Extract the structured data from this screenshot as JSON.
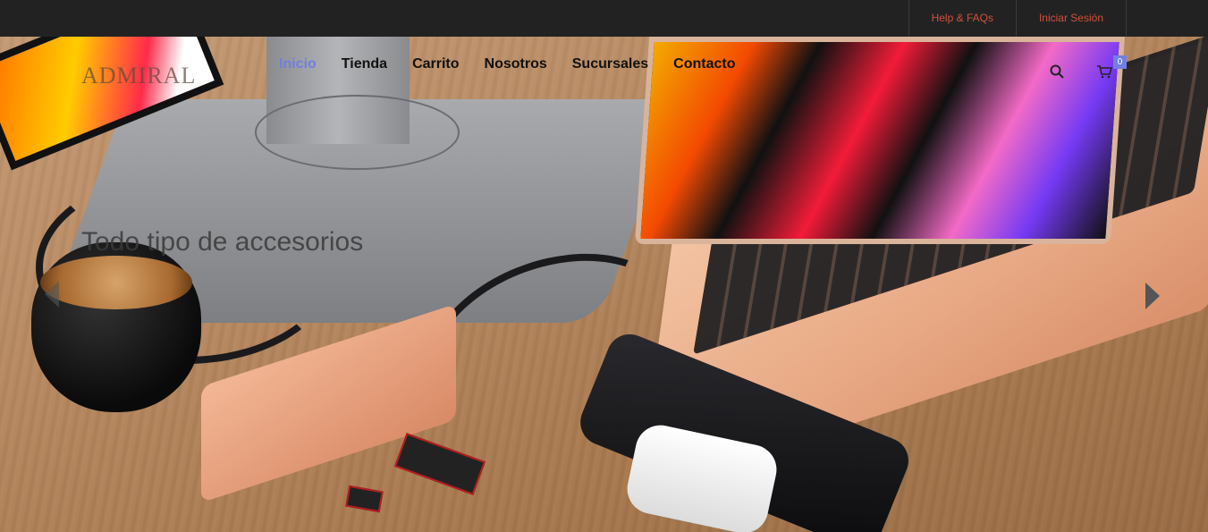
{
  "topbar": {
    "links": [
      {
        "label": "Help & FAQs"
      },
      {
        "label": "Iniciar Sesión"
      }
    ],
    "link_color": "#d0523c"
  },
  "header": {
    "logo": "ADMIRAL",
    "nav": [
      {
        "label": "Inicio",
        "active": true
      },
      {
        "label": "Tienda",
        "active": false
      },
      {
        "label": "Carrito",
        "active": false
      },
      {
        "label": "Nosotros",
        "active": false
      },
      {
        "label": "Sucursales",
        "active": false
      },
      {
        "label": "Contacto",
        "active": false
      }
    ],
    "accent_color": "#717fe0",
    "icons": {
      "search": "search-icon",
      "cart": "cart-icon"
    },
    "cart_count": "0"
  },
  "slider": {
    "caption": "Todo tipo de accesorios",
    "prev_icon": "chevron-left-icon",
    "next_icon": "chevron-right-icon"
  }
}
